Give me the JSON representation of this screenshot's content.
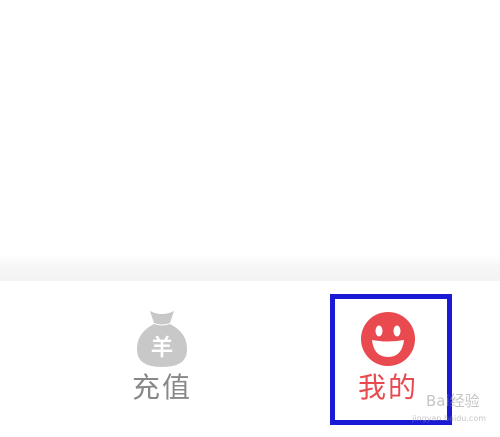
{
  "tabbar": {
    "tabs": [
      {
        "label": "充值",
        "icon": "money-bag-icon",
        "icon_glyph": "羊",
        "active": false
      },
      {
        "label": "我的",
        "icon": "smiley-face-icon",
        "active": true
      }
    ]
  },
  "watermark": {
    "logo_text": "Bai经验",
    "site": "jingyan.baidu.com"
  },
  "colors": {
    "active": "#e84a4f",
    "inactive": "#888888",
    "inactive_icon": "#c8c8c8",
    "highlight_box": "#1a1ad6"
  }
}
